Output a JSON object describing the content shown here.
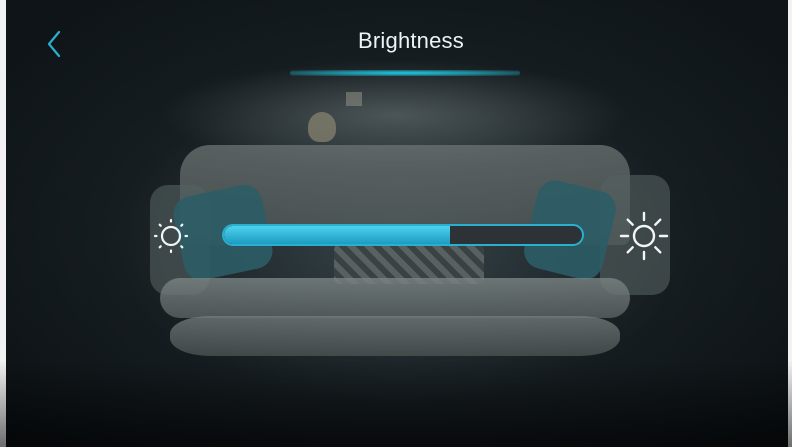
{
  "header": {
    "title": "Brightness",
    "back_icon": "chevron-left-icon"
  },
  "brightness": {
    "level_fraction": 0.63,
    "min_icon": "sun-small-icon",
    "max_icon": "sun-large-icon"
  },
  "colors": {
    "accent": "#2ab0cf",
    "slider_fill_top": "#4ed3ee",
    "slider_fill_bottom": "#1c9bc2",
    "track": "#2d3236",
    "text": "#eef3f5"
  }
}
